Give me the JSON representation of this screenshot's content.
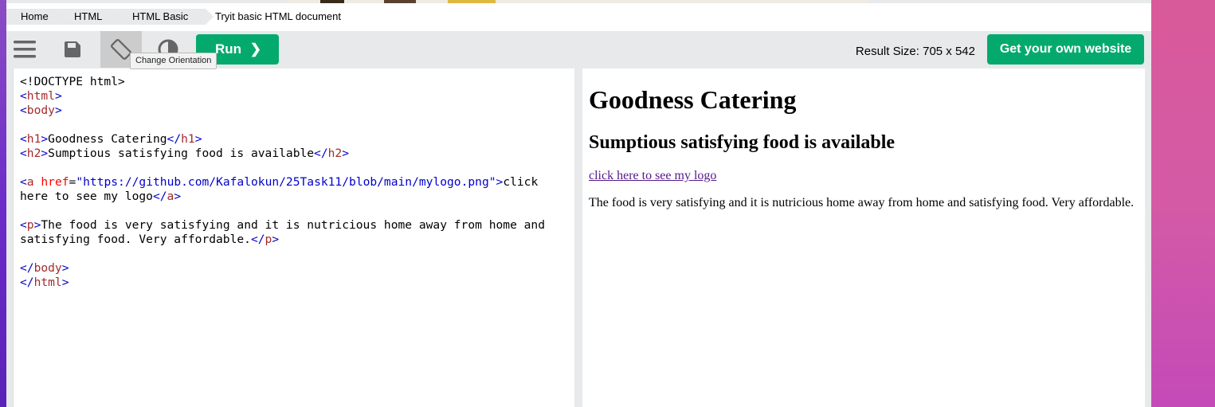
{
  "breadcrumb": {
    "items": [
      "Home",
      "HTML",
      "HTML Basic"
    ],
    "current": "Tryit basic HTML document"
  },
  "toolbar": {
    "icons": [
      "menu-icon",
      "save-icon",
      "change-orientation-icon",
      "theme-icon",
      "chevron-right-icon"
    ],
    "run_label": "Run",
    "run_chevron": "❯",
    "tooltip": "Change Orientation",
    "result_size": "Result Size: 705 x 542",
    "get_website_label": "Get your own website",
    "accent": "#04aa6d"
  },
  "editor": {
    "lines": [
      "<!DOCTYPE html>",
      "<html>",
      "<body>",
      "",
      "<h1>Goodness Catering</h1>",
      "<h2>Sumptious satisfying food is available</h2>",
      "",
      "<a href=\"https://github.com/Kafalokun/25Task11/blob/main/mylogo.png\">click",
      "here to see my logo</a>",
      "",
      "<p>The food is very satisfying and it is nutricious home away from home and",
      "satisfying food. Very affordable.</p>",
      "",
      "</body>",
      "</html>"
    ],
    "tokens": {
      "doctype": "<!DOCTYPE html>",
      "lt": "<",
      "gt": ">",
      "close_lt": "</",
      "eq": "=",
      "html": "html",
      "body": "body",
      "h1": "h1",
      "h2": "h2",
      "a": "a",
      "p": "p",
      "href_attr": "href",
      "href_value": "\"https://github.com/Kafalokun/25Task11/blob/main/mylogo.png\"",
      "h1_text": "Goodness Catering",
      "h2_text": "Sumptious satisfying food is available",
      "a_text_1": "click",
      "a_text_2": "here to see my logo",
      "p_text_1": "The food is very satisfying and it is nutricious home away from home and",
      "p_text_2": "satisfying food. Very affordable."
    }
  },
  "result": {
    "h1": "Goodness Catering",
    "h2": "Sumptious satisfying food is available",
    "link": "click here to see my logo",
    "link_href": "https://github.com/Kafalokun/25Task11/blob/main/mylogo.png",
    "paragraph": "The food is very satisfying and it is nutricious home away from home and satisfying food. Very affordable."
  }
}
